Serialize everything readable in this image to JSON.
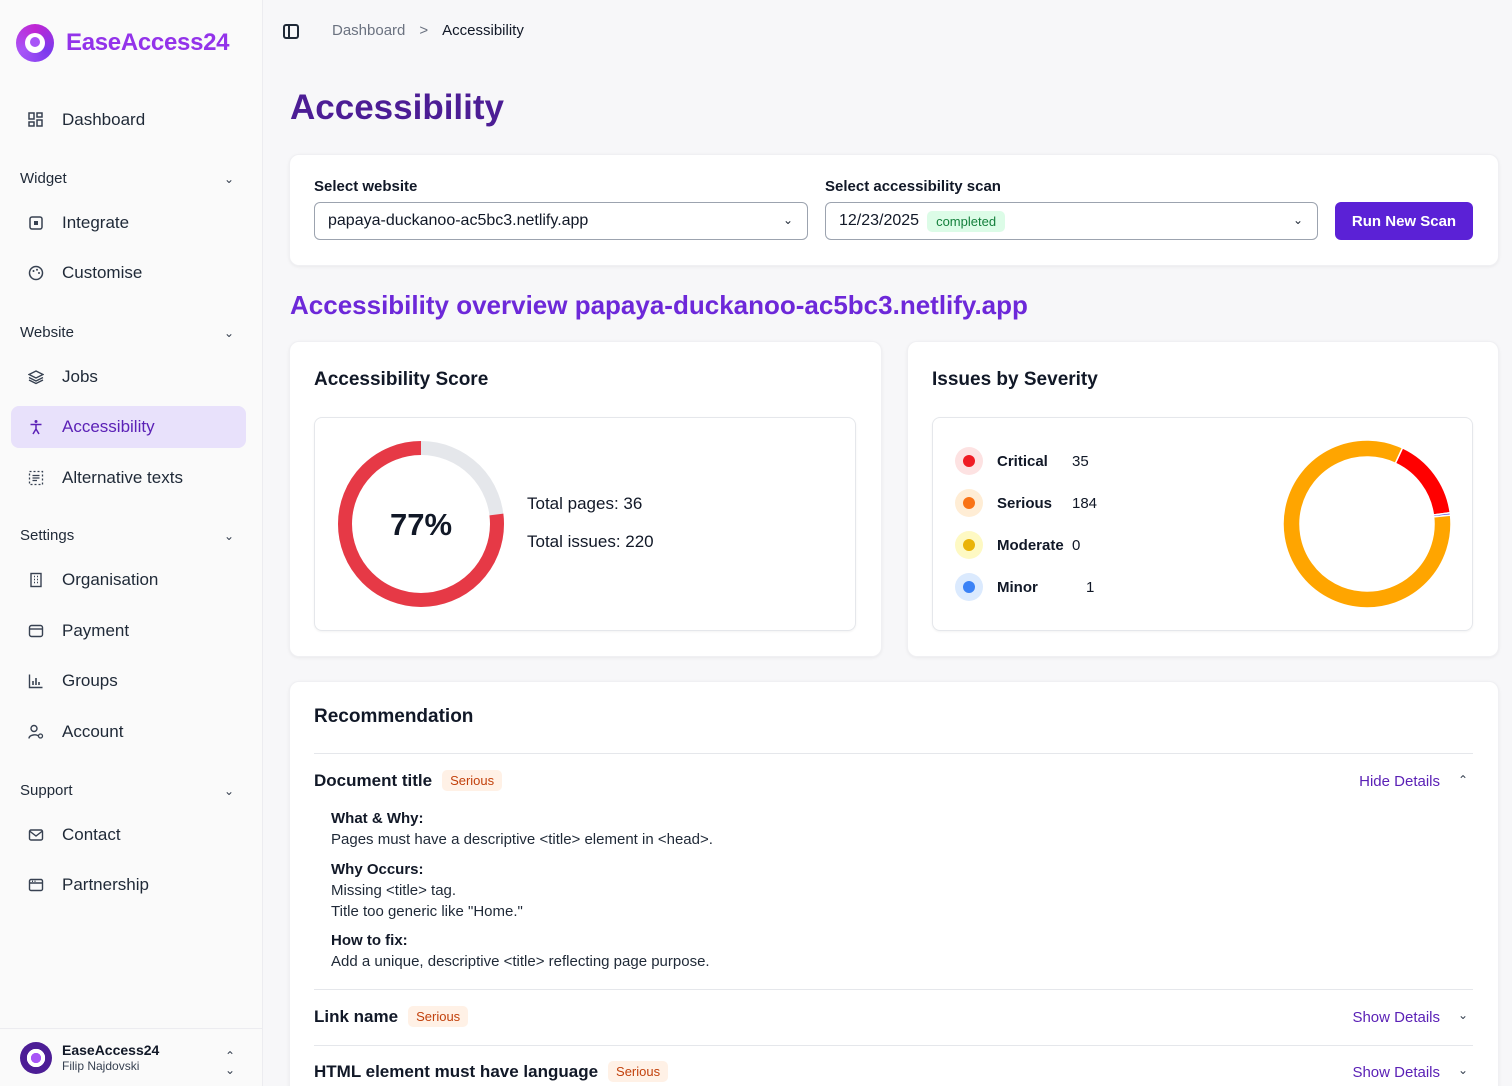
{
  "brand": {
    "name": "EaseAccess24"
  },
  "nav": {
    "dashboard": "Dashboard",
    "widget_section": "Widget",
    "integrate": "Integrate",
    "customise": "Customise",
    "website_section": "Website",
    "jobs": "Jobs",
    "accessibility": "Accessibility",
    "alt_texts": "Alternative texts",
    "settings_section": "Settings",
    "organisation": "Organisation",
    "payment": "Payment",
    "groups": "Groups",
    "account": "Account",
    "support_section": "Support",
    "contact": "Contact",
    "partnership": "Partnership"
  },
  "user": {
    "org": "EaseAccess24",
    "name": "Filip Najdovski"
  },
  "breadcrumb": {
    "parent": "Dashboard",
    "separator": ">",
    "current": "Accessibility"
  },
  "page": {
    "title": "Accessibility"
  },
  "controls": {
    "website_label": "Select website",
    "website_value": "papaya-duckanoo-ac5bc3.netlify.app",
    "scan_label": "Select accessibility scan",
    "scan_date": "12/23/2025",
    "scan_status": "completed",
    "run_button": "Run New Scan"
  },
  "overview": {
    "title": "Accessibility overview papaya-duckanoo-ac5bc3.netlify.app"
  },
  "score": {
    "title": "Accessibility Score",
    "value": 77,
    "label": "77%",
    "total_pages": "Total pages: 36",
    "total_issues": "Total issues: 220",
    "ring_color": "#e63946",
    "track_color": "#e5e7eb"
  },
  "severity": {
    "title": "Issues by Severity",
    "items": [
      {
        "name": "Critical",
        "count": "35",
        "color": "#ef1c24",
        "bg": "#fde2e2"
      },
      {
        "name": "Serious",
        "count": "184",
        "color": "#f97316",
        "bg": "#ffedd5"
      },
      {
        "name": "Moderate",
        "count": "0",
        "color": "#eab308",
        "bg": "#fef9c3"
      },
      {
        "name": "Minor",
        "count": "1",
        "color": "#3b82f6",
        "bg": "#dbeafe"
      }
    ]
  },
  "chart_data": {
    "type": "pie",
    "categories": [
      "Critical",
      "Serious",
      "Moderate",
      "Minor"
    ],
    "values": [
      35,
      184,
      0,
      1
    ],
    "colors": [
      "#ff0000",
      "#ffa500",
      "#eab308",
      "#4f46e5"
    ]
  },
  "recommendation": {
    "title": "Recommendation",
    "items": [
      {
        "name": "Document title",
        "severity": "Serious",
        "toggle": "Hide Details",
        "what_h": "What & Why:",
        "what_t": "Pages must have a descriptive <title> element in <head>.",
        "occurs_h": "Why Occurs:",
        "occurs_t1": "Missing <title> tag.",
        "occurs_t2": "Title too generic like \"Home.\"",
        "fix_h": "How to fix:",
        "fix_t": "Add a unique, descriptive <title> reflecting page purpose."
      },
      {
        "name": "Link name",
        "severity": "Serious",
        "toggle": "Show Details"
      },
      {
        "name": "HTML element must have language",
        "severity": "Serious",
        "toggle": "Show Details"
      }
    ]
  }
}
